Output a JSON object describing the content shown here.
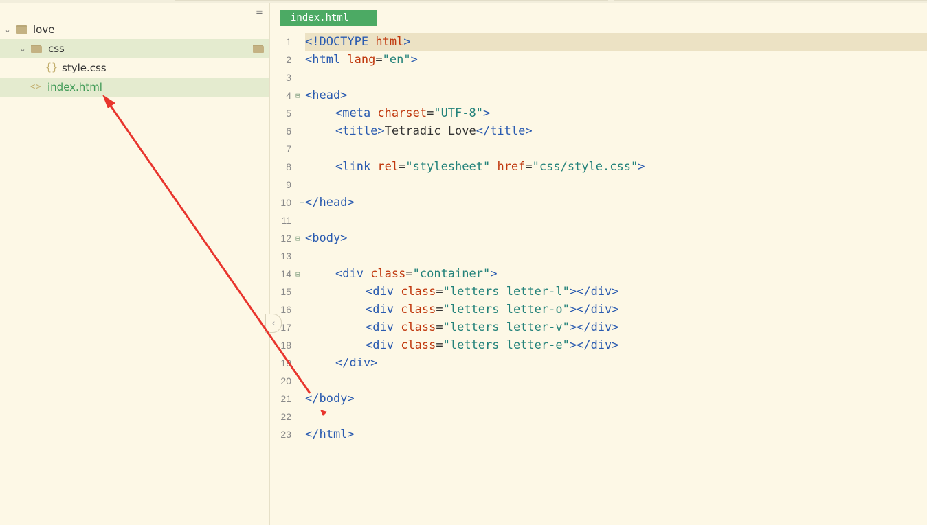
{
  "sidebar": {
    "menu_icon": "hamburger-menu-icon",
    "tree": {
      "root_folder": "love",
      "subfolder": "css",
      "css_file": "style.css",
      "html_file": "index.html"
    }
  },
  "editor": {
    "active_tab": "index.html",
    "line_numbers": [
      "1",
      "2",
      "3",
      "4",
      "5",
      "6",
      "7",
      "8",
      "9",
      "10",
      "11",
      "12",
      "13",
      "14",
      "15",
      "16",
      "17",
      "18",
      "19",
      "20",
      "21",
      "22",
      "23"
    ],
    "tokens": {
      "l1": [
        "<!DOCTYPE",
        " html",
        ">"
      ],
      "l2": [
        "<html",
        " lang",
        "=",
        "\"en\"",
        ">"
      ],
      "l4": [
        "<head>"
      ],
      "l5": [
        "<meta",
        " charset",
        "=",
        "\"UTF-8\"",
        ">"
      ],
      "l6": [
        "<title>",
        "Tetradic Love",
        "</title>"
      ],
      "l8": [
        "<link",
        " rel",
        "=",
        "\"stylesheet\"",
        " href",
        "=",
        "\"css/style.css\"",
        ">"
      ],
      "l10": [
        "</head>"
      ],
      "l12": [
        "<body>"
      ],
      "l14": [
        "<div",
        " class",
        "=",
        "\"container\"",
        ">"
      ],
      "l15": [
        "<div",
        " class",
        "=",
        "\"letters letter-l\"",
        "></div>"
      ],
      "l16": [
        "<div",
        " class",
        "=",
        "\"letters letter-o\"",
        "></div>"
      ],
      "l17": [
        "<div",
        " class",
        "=",
        "\"letters letter-v\"",
        "></div>"
      ],
      "l18": [
        "<div",
        " class",
        "=",
        "\"letters letter-e\"",
        "></div>"
      ],
      "l19": [
        "</div>"
      ],
      "l21": [
        "</body>"
      ],
      "l23": [
        "</html>"
      ]
    }
  },
  "colors": {
    "background": "#fdf8e6",
    "tab_active": "#4caa64",
    "selected_row": "#e4ebcf",
    "tag": "#2a5bb0",
    "attribute": "#c0380e",
    "string": "#23827a",
    "annotation_arrow": "#e8352d"
  }
}
